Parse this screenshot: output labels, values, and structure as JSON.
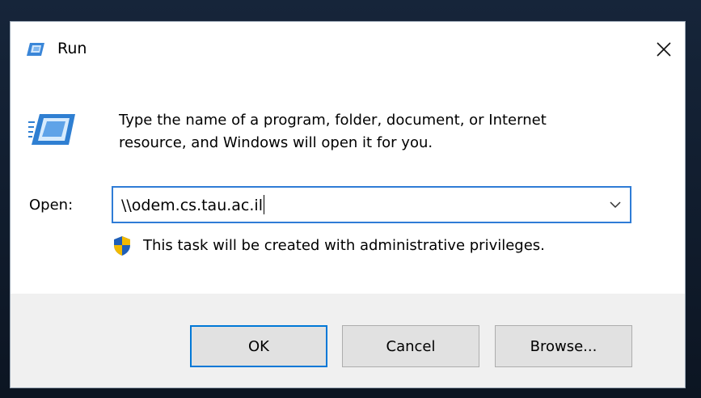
{
  "window": {
    "title": "Run",
    "accent_color": "#0078d7"
  },
  "icons": {
    "title": "run-icon",
    "big": "run-icon",
    "close": "close-icon",
    "dropdown": "chevron-down-icon",
    "uac": "uac-shield-icon"
  },
  "description": {
    "line1": "Type the name of a program, folder, document, or Internet",
    "line2": "resource, and Windows will open it for you."
  },
  "open_field": {
    "label": "Open:",
    "value": "\\\\odem.cs.tau.ac.il"
  },
  "admin_note": "This task will be created with administrative privileges.",
  "buttons": {
    "ok": "OK",
    "cancel": "Cancel",
    "browse": "Browse..."
  }
}
